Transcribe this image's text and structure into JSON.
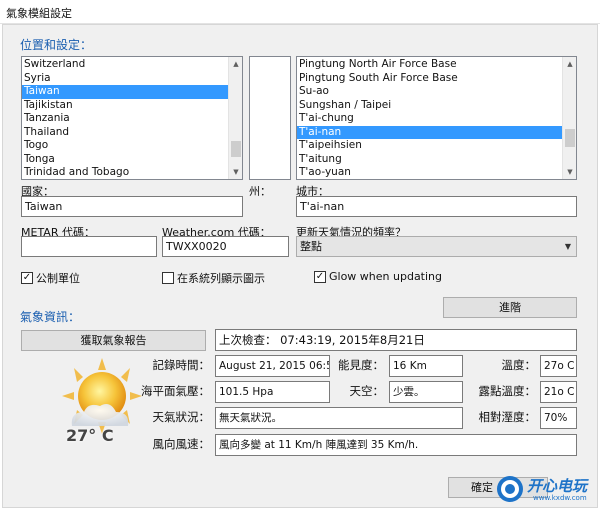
{
  "window": {
    "title": "氣象模組設定"
  },
  "location": {
    "group_title": "位置和設定：",
    "countries": [
      "Switzerland",
      "Syria",
      "Taiwan",
      "Tajikistan",
      "Tanzania",
      "Thailand",
      "Togo",
      "Tonga",
      "Trinidad and Tobago"
    ],
    "countries_selected_index": 2,
    "cities": [
      "Pingtung North Air Force Base",
      "Pingtung South Air Force Base",
      "Su-ao",
      "Sungshan / Taipei",
      "T'ai-chung",
      "T'ai-nan",
      "T'aipeihsien",
      "T'aitung",
      "T'ao-yuan"
    ],
    "cities_selected_index": 5,
    "country_label": "國家：",
    "country_value": "Taiwan",
    "state_label": "州：",
    "city_label": "城市：",
    "city_value": "T'ai-nan",
    "metar_label": "METAR 代碼：",
    "metar_value": "",
    "weathercom_label": "Weather.com 代碼：",
    "weathercom_value": "TWXX0020",
    "frequency_label": "更新天氣情況的頻率？",
    "frequency_value": "整點"
  },
  "options": {
    "metric_label": "公制單位",
    "metric_checked": true,
    "tray_label": "在系統列顯示圖示",
    "tray_checked": false,
    "glow_label": "Glow when updating",
    "glow_checked": true,
    "advanced_button": "進階"
  },
  "weather": {
    "group_title": "氣象資訊：",
    "get_report_button": "獲取氣象報告",
    "last_check_label": "上次檢查：",
    "last_check_value": "07:43:19, 2015年8月21日",
    "record_time_label": "記錄時間：",
    "record_time_value": "August 21, 2015 06:51",
    "visibility_label": "能見度：",
    "visibility_value": "16 Km",
    "temperature_label": "溫度：",
    "temperature_value": "27o C",
    "pressure_label": "海平面氣壓：",
    "pressure_value": "101.5 Hpa",
    "sky_label": "天空：",
    "sky_value": "少雲。",
    "dewpoint_label": "露點溫度：",
    "dewpoint_value": "21o C",
    "condition_label": "天氣狀況：",
    "condition_value": "無天氣狀況。",
    "humidity_label": "相對溼度：",
    "humidity_value": "70%",
    "wind_label": "風向風速：",
    "wind_value": "風向多變 at 11 Km/h 陣風達到 35 Km/h.",
    "icon_temperature": "27° C",
    "icon": "sun-cloud-icon"
  },
  "footer": {
    "ok_button": "確定"
  },
  "watermark": {
    "brand": "开心电玩",
    "url": "www.kxdw.com"
  },
  "colors": {
    "accent": "#3399ff",
    "group_title": "#1b5fb0"
  }
}
